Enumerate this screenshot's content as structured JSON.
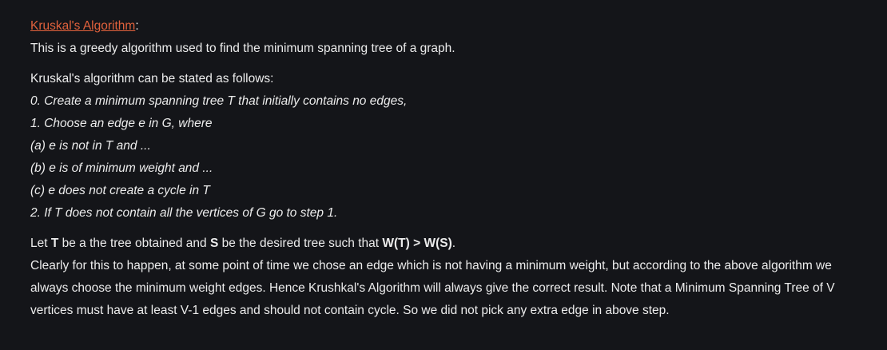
{
  "title": {
    "link_text": "Kruskal's Algorithm",
    "suffix": ":"
  },
  "intro": "This is a greedy algorithm used to find the minimum spanning tree of a graph.",
  "statement_heading": "Kruskal's algorithm can be stated as follows:",
  "steps": [
    "0. Create a minimum spanning tree T that initially contains no edges,",
    "1. Choose an edge e in G, where",
    "(a) e is not in T and ...",
    "(b) e is of minimum weight and ...",
    "(c) e does not create a cycle in T",
    "2. If T does not contain all the vertices of G go to step 1."
  ],
  "proof": {
    "p1": "Let ",
    "t": "T",
    "p2": " be a the tree obtained and ",
    "s": "S",
    "p3": " be the desired tree such that ",
    "cond": "W(T) > W(S)",
    "p4": ".",
    "body": "Clearly for this to happen, at some point of time we chose an edge which is not having a minimum weight, but according to the above algorithm we always choose the minimum weight edges. Hence Krushkal's Algorithm will always give the correct result. Note that a Minimum Spanning Tree of V vertices must have at least V-1 edges and should not contain cycle. So we did not pick any extra edge in above step."
  },
  "colors": {
    "background": "#141519",
    "text": "#ececec",
    "link": "#e0613c"
  }
}
